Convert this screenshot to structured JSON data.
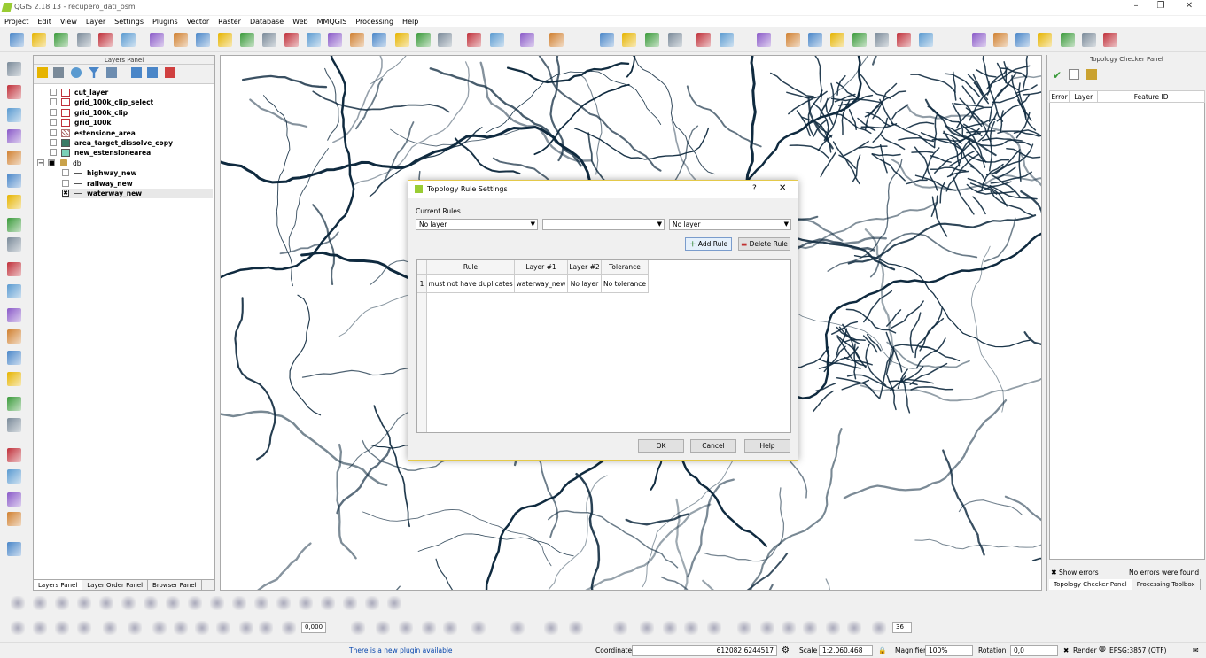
{
  "window": {
    "title": "QGIS 2.18.13 - recupero_dati_osm"
  },
  "menu": [
    "Project",
    "Edit",
    "View",
    "Layer",
    "Settings",
    "Plugins",
    "Vector",
    "Raster",
    "Database",
    "Web",
    "MMQGIS",
    "Processing",
    "Help"
  ],
  "layers_panel": {
    "title": "Layers Panel",
    "layers": [
      {
        "name": "cut_layer",
        "symbol": "poly-outline",
        "color": "#c0303a"
      },
      {
        "name": "grid_100k_clip_select",
        "symbol": "poly-outline",
        "color": "#c0303a"
      },
      {
        "name": "grid_100k_clip",
        "symbol": "poly-outline",
        "color": "#c0303a"
      },
      {
        "name": "grid_100k",
        "symbol": "poly-outline",
        "color": "#c0303a"
      },
      {
        "name": "estensione_area",
        "symbol": "hatched",
        "color": "#b07070"
      },
      {
        "name": "area_target_dissolve_copy",
        "symbol": "fill",
        "color": "#3a7a66"
      },
      {
        "name": "new_estensionearea",
        "symbol": "fill",
        "color": "#7ad0b8"
      }
    ],
    "group": {
      "name": "db",
      "children": [
        {
          "name": "highway_new",
          "checked": false
        },
        {
          "name": "railway_new",
          "checked": false
        },
        {
          "name": "waterway_new",
          "checked": true
        }
      ]
    },
    "tabs": [
      "Layers Panel",
      "Layer Order Panel",
      "Browser Panel"
    ]
  },
  "topology_panel": {
    "title": "Topology Checker Panel",
    "columns": [
      "Error",
      "Layer",
      "Feature ID"
    ],
    "show_errors": "Show errors",
    "status": "No errors were found",
    "tabs": [
      "Topology Checker Panel",
      "Processing Toolbox"
    ]
  },
  "dialog": {
    "title": "Topology Rule Settings",
    "help_glyph": "?",
    "close_glyph": "✕",
    "current_rules_label": "Current Rules",
    "combo1": "No layer",
    "combo2": "",
    "combo3": "No layer",
    "add_rule": "Add Rule",
    "delete_rule": "Delete Rule",
    "table": {
      "headers": [
        "Rule",
        "Layer #1",
        "Layer #2",
        "Tolerance"
      ],
      "rows": [
        {
          "num": "1",
          "rule": "must not have duplicates",
          "layer1": "waterway_new",
          "layer2": "No layer",
          "tolerance": "No tolerance"
        }
      ]
    },
    "ok": "OK",
    "cancel": "Cancel",
    "help": "Help"
  },
  "status": {
    "plugin_link": "There is a new plugin available",
    "coordinate_label": "Coordinate",
    "coordinate": "612082,6244517",
    "scale_label": "Scale",
    "scale": "1:2.060.468",
    "magnifier_label": "Magnifier",
    "magnifier": "100%",
    "rotation_label": "Rotation",
    "rotation": "0,0",
    "render_label": "Render",
    "crs": "EPSG:3857 (OTF)"
  },
  "toolbar_values": {
    "offset": "0,000",
    "sides": "36"
  },
  "map": {
    "line_color": "#0f2a3f"
  }
}
